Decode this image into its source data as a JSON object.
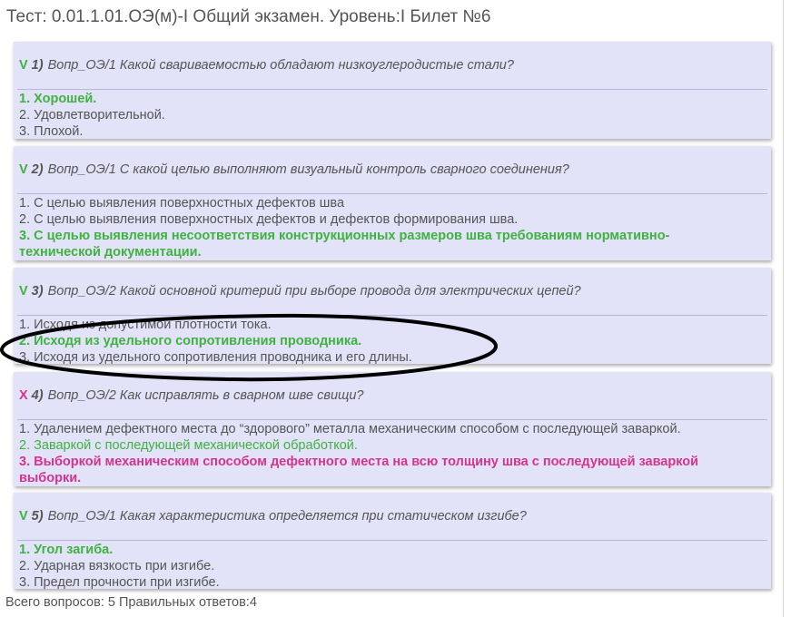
{
  "title": "Тест: 0.01.1.01.ОЭ(м)-I Общий экзамен. Уровень:I Билет №6",
  "questions": [
    {
      "mark": "V",
      "status": "ok",
      "number": "1)",
      "text": "Вопр_ОЭ/1 Какой свариваемостью обладают низкоуглеродистые стали?",
      "answers": [
        {
          "text": "1. Хорошей.",
          "state": "correct"
        },
        {
          "text": "2. Удовлетворительной.",
          "state": "normal"
        },
        {
          "text": "3. Плохой.",
          "state": "normal"
        }
      ]
    },
    {
      "mark": "V",
      "status": "ok",
      "number": "2)",
      "text": "Вопр_ОЭ/1 С какой целью выполняют визуальный контроль сварного соединения?",
      "answers": [
        {
          "text": "1. С целью выявления поверхностных дефектов шва",
          "state": "normal"
        },
        {
          "text": "2. С целью выявления поверхностных дефектов и дефектов формирования шва.",
          "state": "normal"
        },
        {
          "text": "3. С целью выявления несоответствия конструкционных размеров шва требованиям нормативно-технической документации.",
          "state": "correct"
        }
      ]
    },
    {
      "mark": "V",
      "status": "ok",
      "number": "3)",
      "text": "Вопр_ОЭ/2 Какой основной критерий при выборе провода для электрических цепей?",
      "answers": [
        {
          "text": "1. Исходя из допустимой плотности тока.",
          "state": "normal"
        },
        {
          "text": "2. Исходя из удельного сопротивления проводника.",
          "state": "correct"
        },
        {
          "text": "3. Исходя из удельного сопротивления проводника и его длины.",
          "state": "normal"
        }
      ]
    },
    {
      "mark": "X",
      "status": "bad",
      "number": "4)",
      "text": "Вопр_ОЭ/2 Как исправлять в сварном шве свищи?",
      "answers": [
        {
          "text": "1. Удалением дефектного места до “здорового” металла механическим способом с последующей заваркой.",
          "state": "normal"
        },
        {
          "text": "2. Заваркой с последующей механической обработкой.",
          "state": "correct-plain"
        },
        {
          "text": "3. Выборкой механическим способом дефектного места на всю толщину шва с последующей заваркой выборки.",
          "state": "wrong-chosen"
        }
      ]
    },
    {
      "mark": "V",
      "status": "ok",
      "number": "5)",
      "text": "Вопр_ОЭ/1 Какая характеристика определяется при статическом изгибе?",
      "answers": [
        {
          "text": "1. Угол загиба.",
          "state": "correct"
        },
        {
          "text": "2. Ударная вязкость при изгибе.",
          "state": "normal"
        },
        {
          "text": "3. Предел прочности при изгибе.",
          "state": "normal"
        }
      ]
    }
  ],
  "footer": {
    "summary": "Всего вопросов: 5 Правильных ответов:4"
  },
  "colors": {
    "card_bg": "#e2e2f8",
    "correct": "#3fb23f",
    "wrong": "#d6338f",
    "text": "#555555",
    "annotation": "#000000"
  }
}
